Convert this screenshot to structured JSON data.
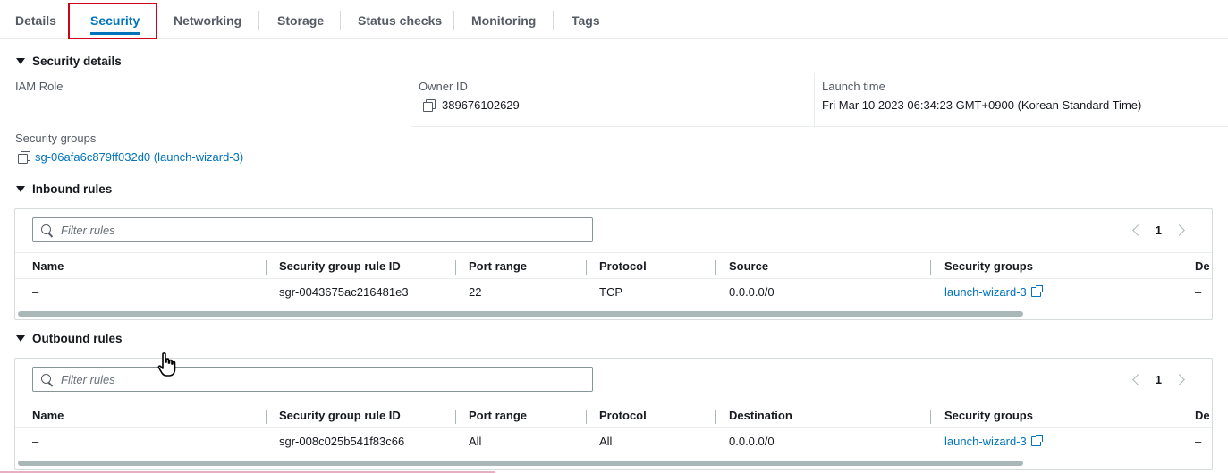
{
  "tabs": [
    "Details",
    "Security",
    "Networking",
    "Storage",
    "Status checks",
    "Monitoring",
    "Tags"
  ],
  "active_tab": "Security",
  "security_details": {
    "title": "Security details",
    "iam_role_label": "IAM Role",
    "iam_role_value": "–",
    "owner_id_label": "Owner ID",
    "owner_id_value": "389676102629",
    "launch_time_label": "Launch time",
    "launch_time_value": "Fri Mar 10 2023 06:34:23 GMT+0900 (Korean Standard Time)",
    "security_groups_label": "Security groups",
    "security_groups_value": "sg-06afa6c879ff032d0 (launch-wizard-3)"
  },
  "inbound": {
    "title": "Inbound rules",
    "filter_placeholder": "Filter rules",
    "page": "1",
    "columns": [
      "Name",
      "Security group rule ID",
      "Port range",
      "Protocol",
      "Source",
      "Security groups",
      "De"
    ],
    "row": {
      "name": "–",
      "rule_id": "sgr-0043675ac216481e3",
      "port_range": "22",
      "protocol": "TCP",
      "source": "0.0.0.0/0",
      "security_group": "launch-wizard-3",
      "description": "–"
    }
  },
  "outbound": {
    "title": "Outbound rules",
    "filter_placeholder": "Filter rules",
    "page": "1",
    "columns": [
      "Name",
      "Security group rule ID",
      "Port range",
      "Protocol",
      "Destination",
      "Security groups",
      "De"
    ],
    "row": {
      "name": "–",
      "rule_id": "sgr-008c025b541f83c66",
      "port_range": "All",
      "protocol": "All",
      "destination": "0.0.0.0/0",
      "security_group": "launch-wizard-3",
      "description": "–"
    }
  },
  "icons": {
    "copy": "copy-icon",
    "search": "search-icon",
    "external_link": "external-link-icon",
    "caret": "caret-down-icon",
    "cursor": "hand-cursor-icon"
  },
  "colors": {
    "accent": "#0073bb",
    "highlight_box": "#d0021b",
    "text": "#16191f",
    "muted": "#545b64"
  }
}
